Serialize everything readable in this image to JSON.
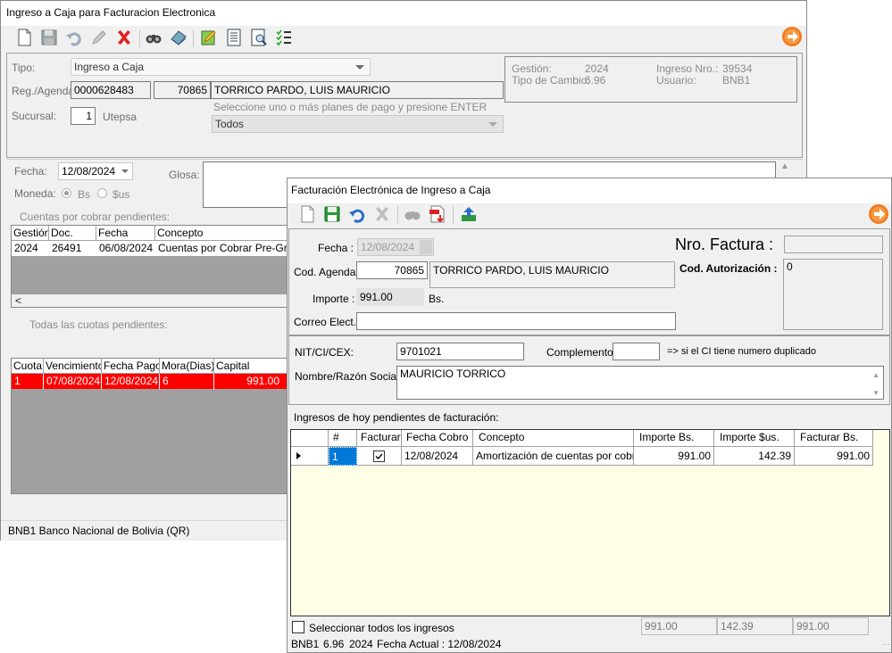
{
  "back_window": {
    "title": "Ingreso a Caja para Facturacion Electronica",
    "tipo_label": "Tipo:",
    "tipo_value": "Ingreso a Caja",
    "reg_agenda_label": "Reg./Agenda:",
    "reg_value": "0000628483",
    "agenda_code": "70865",
    "client_name": "TORRICO PARDO, LUIS MAURICIO",
    "sucursal_label": "Sucursal:",
    "sucursal_value": "1",
    "sucursal_name": "Utepsa",
    "plans_hint": "Seleccione uno o más planes de pago y presione ENTER",
    "plans_value": "Todos",
    "info": {
      "gestion_label": "Gestión:",
      "gestion_value": "2024",
      "tipo_cambio_label": "Tipo de Cambio:",
      "tipo_cambio_value": "6.96",
      "ingreso_nro_label": "Ingreso Nro.:",
      "ingreso_nro_value": "39534",
      "usuario_label": "Usuario:",
      "usuario_value": "BNB1"
    },
    "fecha_label": "Fecha:",
    "fecha_value": "12/08/2024",
    "glosa_label": "Glosa:",
    "moneda_label": "Moneda:",
    "moneda_bs": "Bs",
    "moneda_us": "$us",
    "cxc_label": "Cuentas por cobrar pendientes:",
    "cxc_headers": [
      "Gestión",
      "Doc.",
      "Fecha",
      "Concepto"
    ],
    "cxc_row": [
      "2024",
      "26491",
      "06/08/2024",
      "Cuentas por Cobrar Pre-Grado"
    ],
    "cuotas_label": "Todas las cuotas pendientes:",
    "cuotas_headers": [
      "Cuota",
      "Vencimiento",
      "Fecha Pago",
      "Mora(Dias)",
      "Capital"
    ],
    "cuotas_row": [
      "1",
      "07/08/2024",
      "12/08/2024",
      "6",
      "991.00"
    ],
    "status": "BNB1  Banco Nacional de Bolivia (QR)",
    "colors": {
      "selected_row": "#ff0000"
    }
  },
  "front_window": {
    "title": "Facturación Electrónica de Ingreso a Caja",
    "fecha_label": "Fecha :",
    "fecha_value": "12/08/2024",
    "nro_factura_label": "Nro. Factura :",
    "nro_factura_value": "",
    "cod_agenda_label": "Cod. Agenda:",
    "cod_agenda_value": "70865",
    "cod_agenda_name": "TORRICO PARDO, LUIS MAURICIO",
    "cod_autorizacion_label": "Cod. Autorización :",
    "cod_autorizacion_value": "0",
    "importe_label": "Importe :",
    "importe_value": "991.00",
    "importe_currency": "Bs.",
    "correo_label": "Correo Elect.:",
    "correo_value": "",
    "nit_label": "NIT/CI/CEX:",
    "nit_value": "9701021",
    "complemento_label": "Complemento:",
    "complemento_value": "",
    "complemento_hint": "=> si el CI tiene numero duplicado",
    "razon_label": "Nombre/Razón Social :",
    "razon_value": "MAURICIO TORRICO",
    "grid_title": "Ingresos de hoy pendientes de facturación:",
    "grid_headers": [
      "#",
      "Facturar",
      "Fecha Cobro",
      "Concepto",
      "Importe Bs.",
      "Importe $us.",
      "Facturar Bs."
    ],
    "grid_row": {
      "num": "1",
      "facturar": true,
      "fecha": "12/08/2024",
      "concepto": "Amortización de cuentas por cobrar",
      "importe_bs": "991.00",
      "importe_us": "142.39",
      "facturar_bs": "991.00"
    },
    "select_all_label": "Seleccionar todos los ingresos",
    "totals": {
      "bs": "991.00",
      "us": "142.39",
      "facturar": "991.00"
    },
    "status": {
      "user": "BNB1",
      "rate": "6.96",
      "year": "2024",
      "fecha_actual": "Fecha Actual : 12/08/2024"
    },
    "colors": {
      "grid_bg": "#ffffe8",
      "selected_cell": "#0078d7"
    }
  }
}
